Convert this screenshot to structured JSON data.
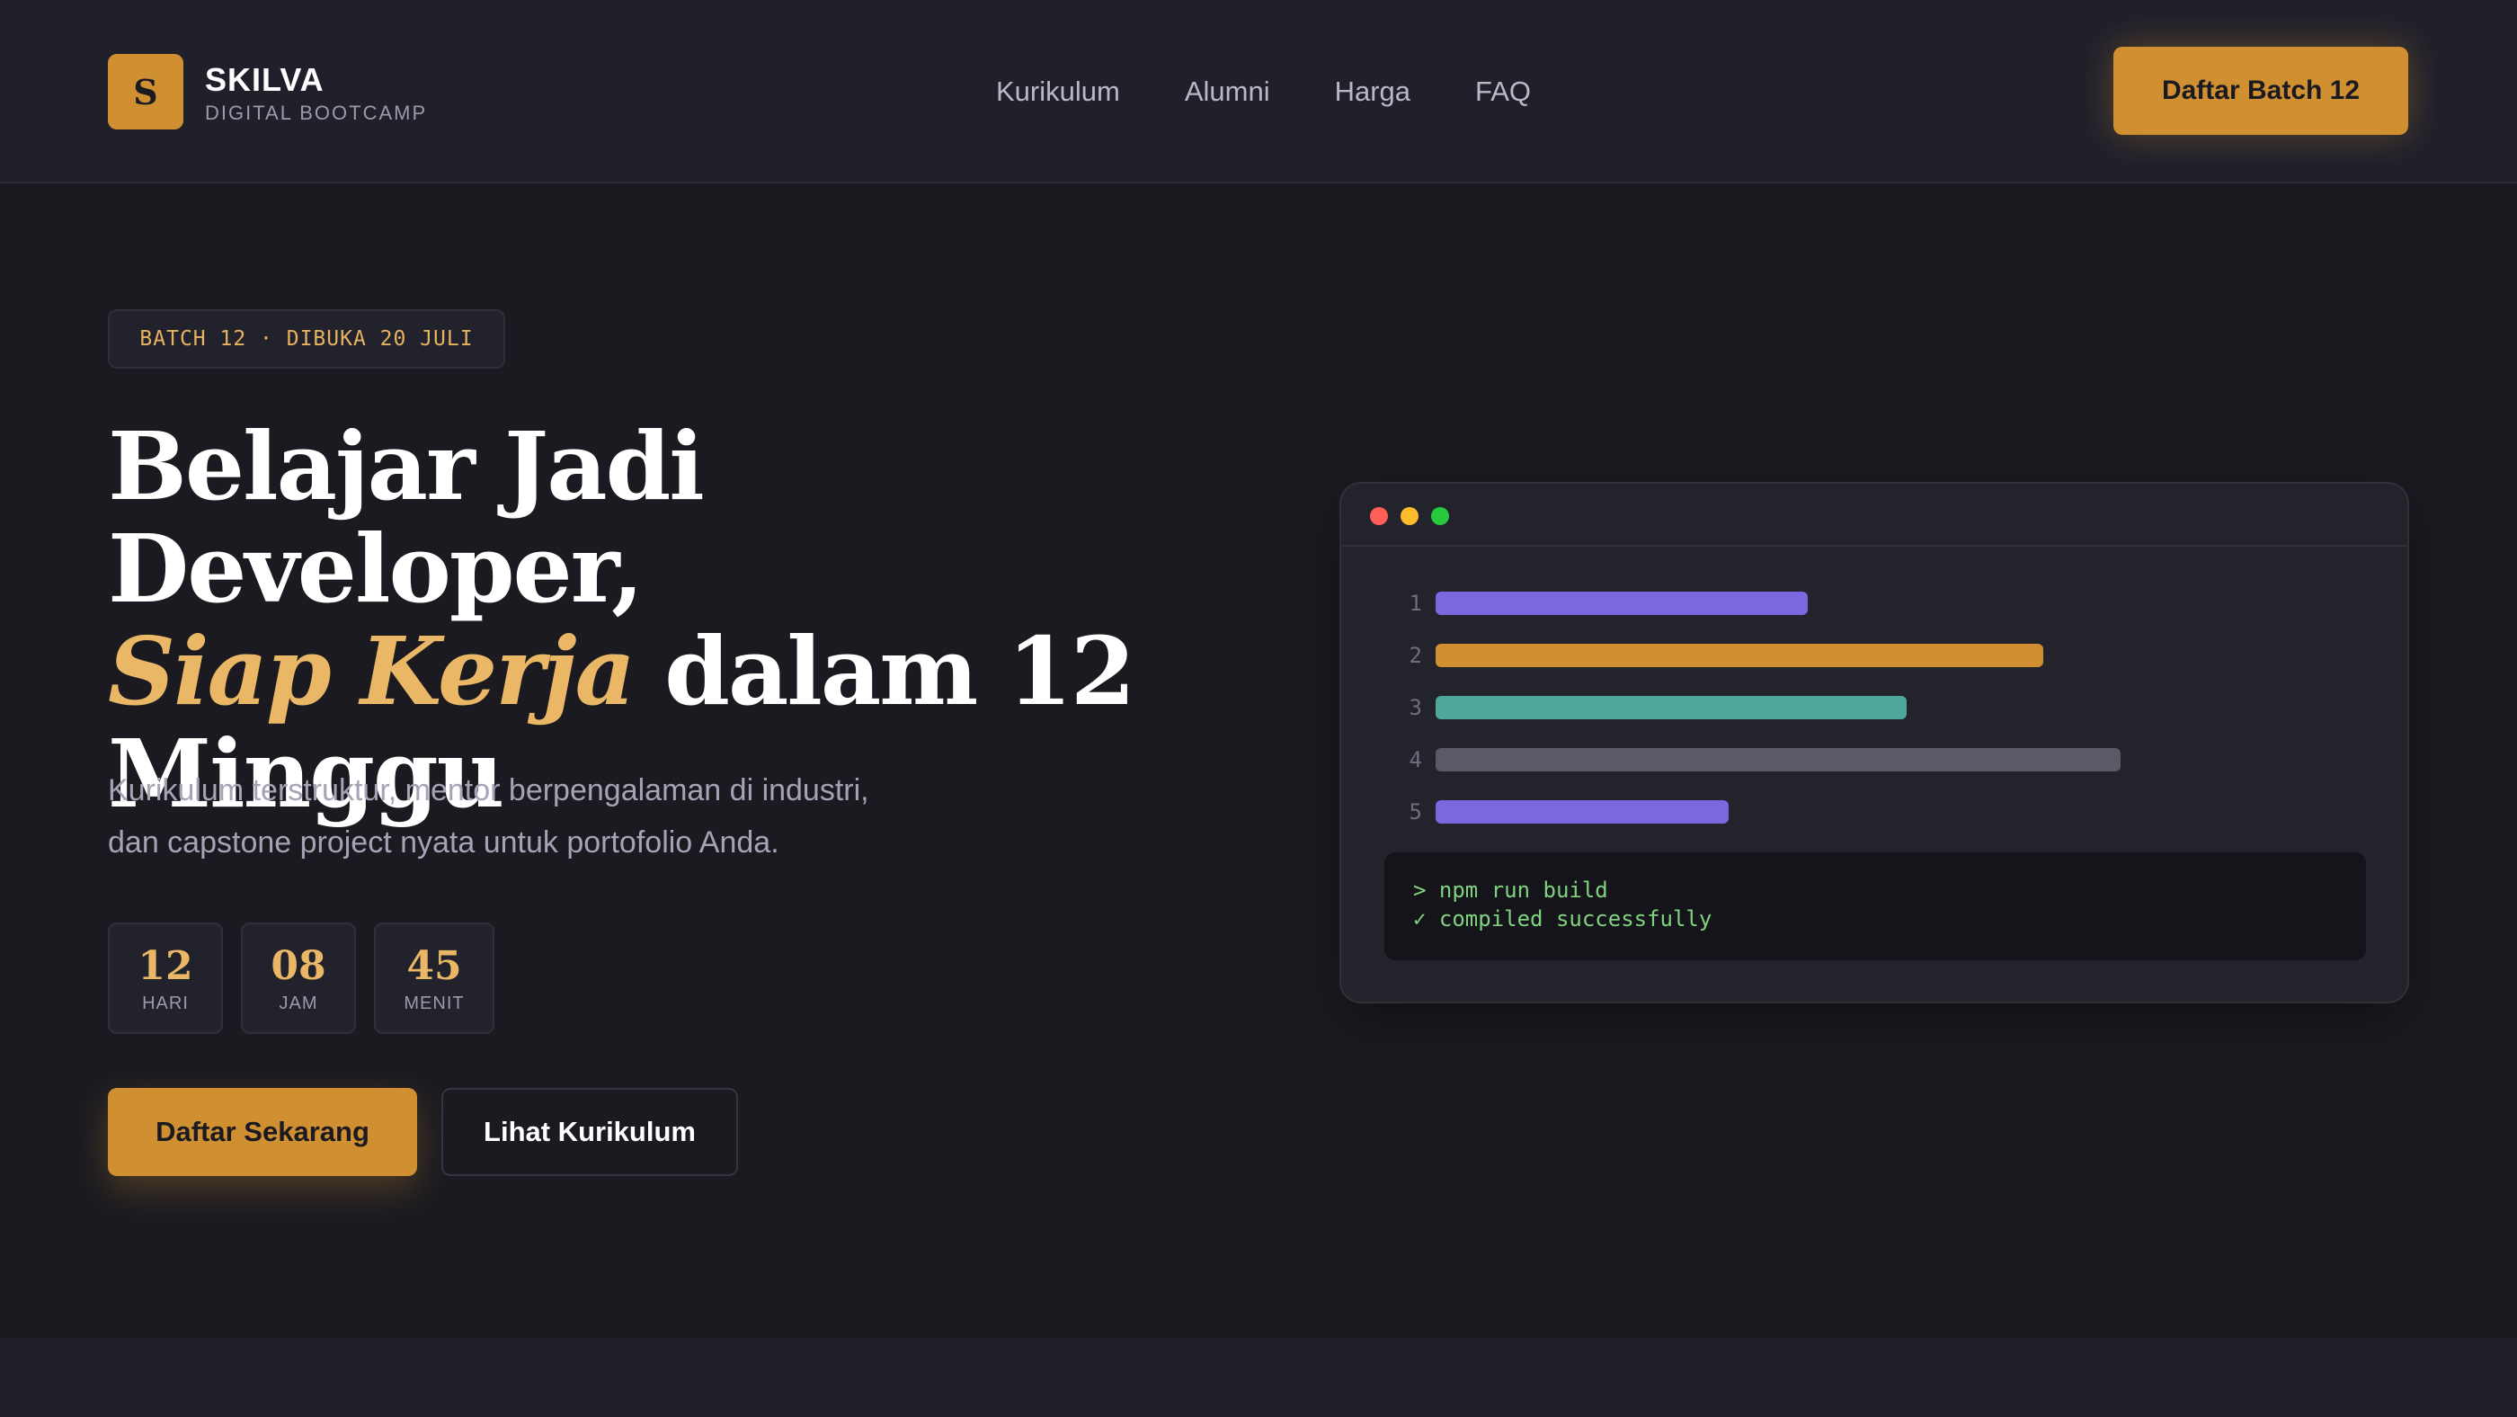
{
  "brand": {
    "logo_letter": "S",
    "name": "SKILVA",
    "subtitle": "DIGITAL BOOTCAMP"
  },
  "nav": {
    "items": [
      {
        "label": "Kurikulum"
      },
      {
        "label": "Alumni"
      },
      {
        "label": "Harga"
      },
      {
        "label": "FAQ"
      }
    ],
    "cta_label": "Daftar Batch 12"
  },
  "hero": {
    "badge": "BATCH 12 · DIBUKA 20 JULI",
    "title_line1": "Belajar Jadi Developer,",
    "title_accent": "Siap Kerja",
    "title_line2_rest": " dalam 12",
    "title_line3": "Minggu",
    "description_line1": "Kurikulum terstruktur, mentor berpengalaman di industri,",
    "description_line2": "dan capstone project nyata untuk portofolio Anda.",
    "countdown": [
      {
        "value": "12",
        "label": "HARI"
      },
      {
        "value": "08",
        "label": "JAM"
      },
      {
        "value": "45",
        "label": "MENIT"
      }
    ],
    "primary_button": "Daftar Sekarang",
    "secondary_button": "Lihat Kurikulum"
  },
  "editor": {
    "window_buttons": [
      "close",
      "minimize",
      "maximize"
    ],
    "lines": [
      {
        "number": "1",
        "color": "#7b68e0"
      },
      {
        "number": "2",
        "color": "#d08f31"
      },
      {
        "number": "3",
        "color": "#4fa69a"
      },
      {
        "number": "4",
        "color": "#5a5a66"
      },
      {
        "number": "5",
        "color": "#7b68e0"
      }
    ],
    "terminal": {
      "command": "> npm run build",
      "result": "✓ compiled successfully"
    }
  },
  "colors": {
    "accent": "#d08f31",
    "accent_light": "#e9b766",
    "background": "#1a1a20",
    "header_bg": "#20202b"
  }
}
